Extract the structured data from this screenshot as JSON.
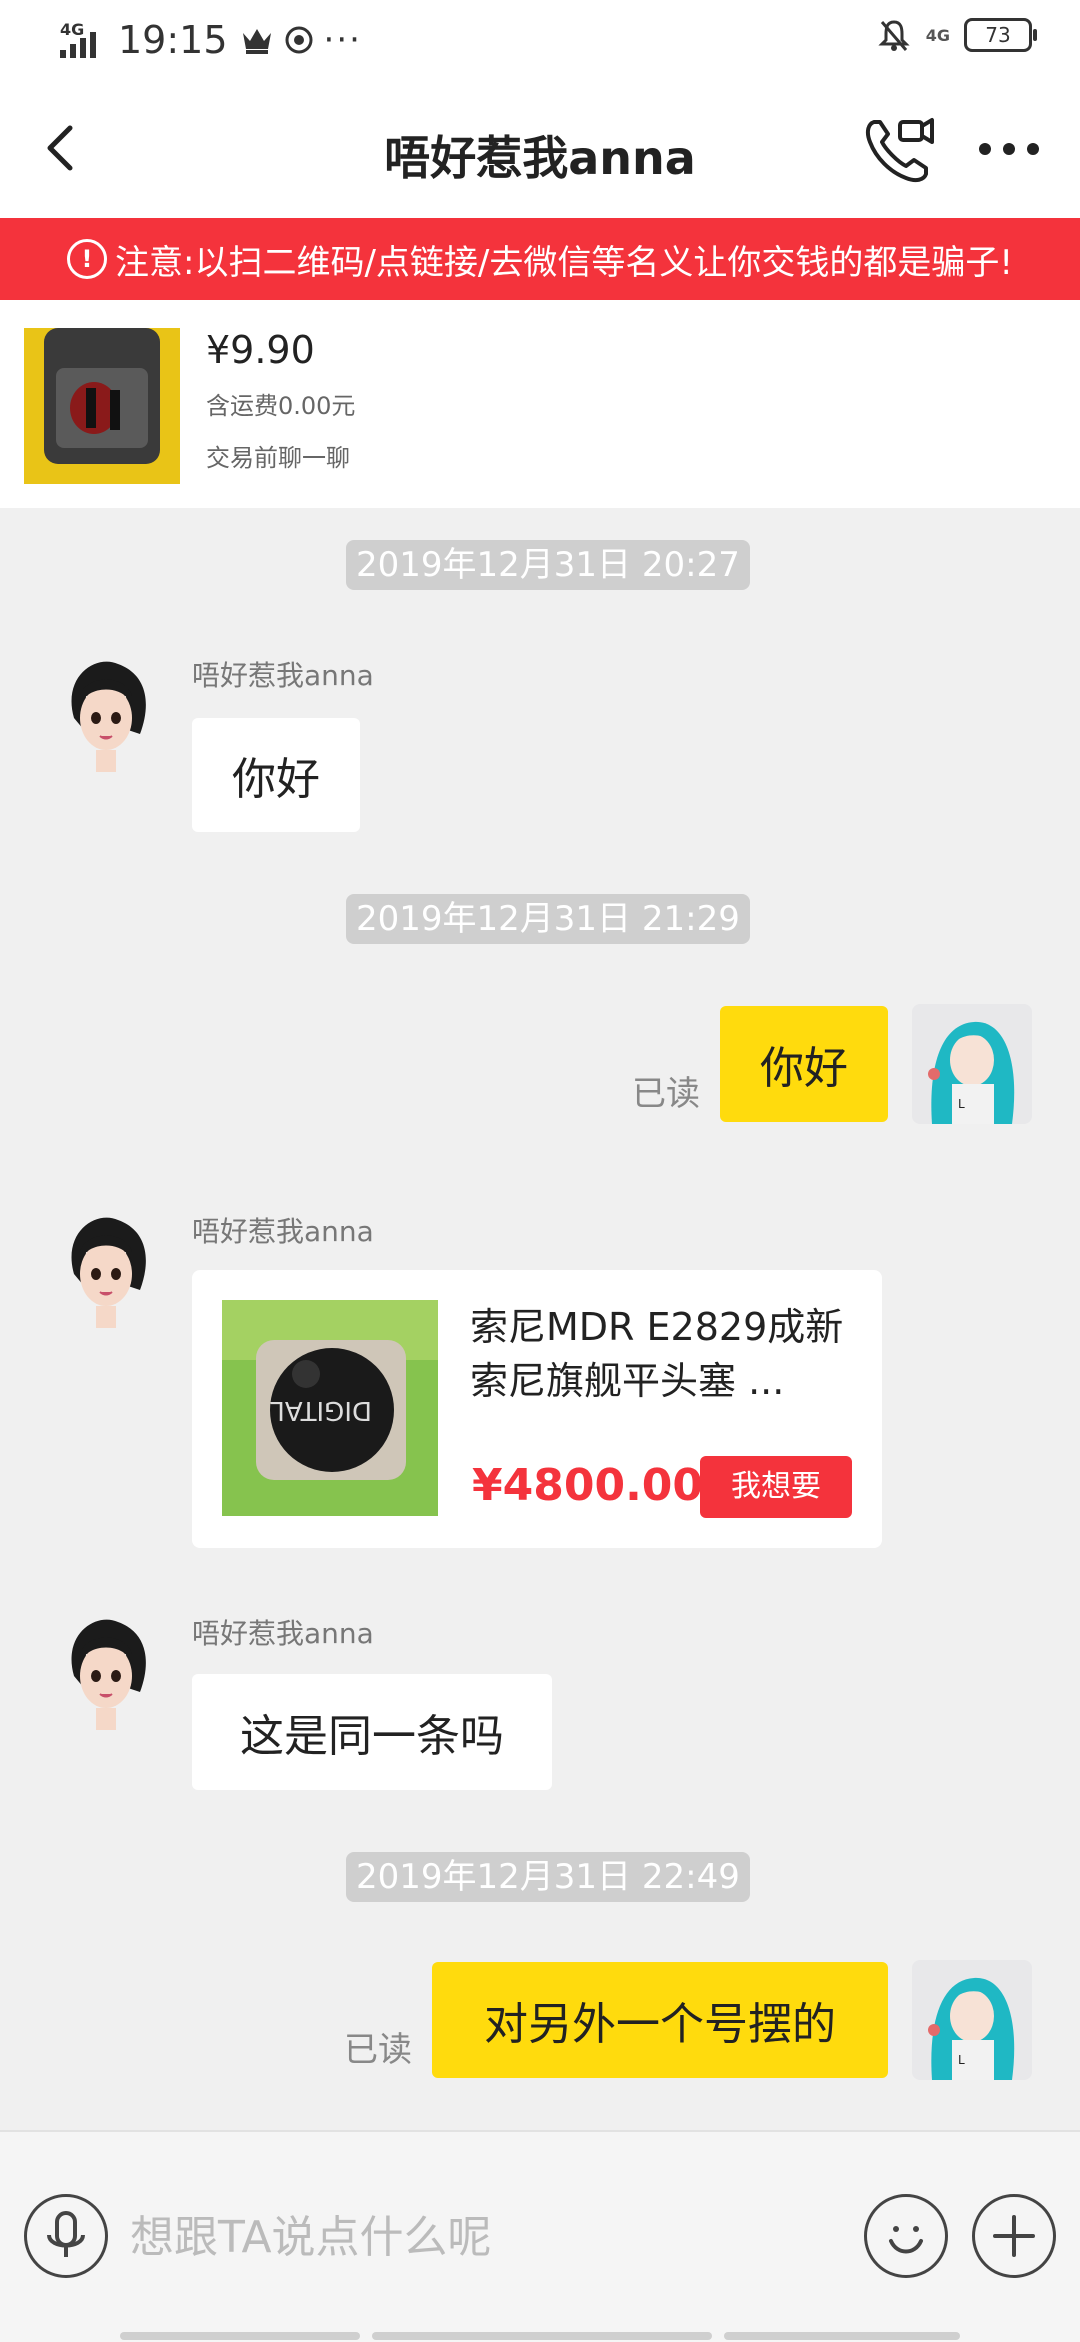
{
  "status_bar": {
    "network": "4G",
    "time": "19:15",
    "more": "···",
    "right_network": "4G",
    "battery": "73"
  },
  "header": {
    "title": "唔好惹我anna"
  },
  "warning": {
    "icon_text": "!",
    "text": "注意:以扫二维码/点链接/去微信等名义让你交钱的都是骗子!"
  },
  "product": {
    "price": "¥9.90",
    "shipping": "含运费0.00元",
    "chat_hint": "交易前聊一聊"
  },
  "messages": {
    "ts1": "2019年12月31日 20:27",
    "sender1": "唔好惹我anna",
    "msg1": "你好",
    "ts2": "2019年12月31日 21:29",
    "read1": "已读",
    "msg2": "你好",
    "sender2": "唔好惹我anna",
    "card": {
      "title": "索尼MDR E2829成新索尼旗舰平头塞 ...",
      "price": "¥4800.00",
      "want_label": "我想要"
    },
    "sender3": "唔好惹我anna",
    "msg3": "这是同一条吗",
    "ts3": "2019年12月31日 22:49",
    "read2": "已读",
    "msg4": "对另外一个号摆的"
  },
  "input": {
    "placeholder": "想跟TA说点什么呢"
  },
  "colors": {
    "warning_bg": "#f4333c",
    "my_bubble": "#ffdb0d",
    "price_red": "#f4333c"
  },
  "icons": [
    "back-arrow-icon",
    "video-call-icon",
    "more-dots-icon",
    "warning-icon",
    "mic-icon",
    "emoji-icon",
    "plus-icon"
  ]
}
